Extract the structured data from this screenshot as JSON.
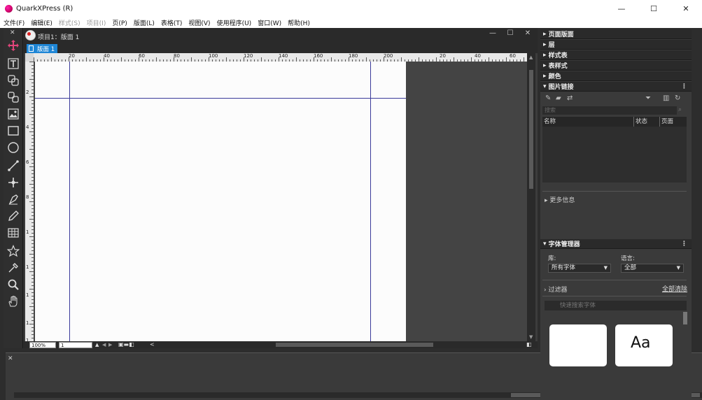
{
  "app": {
    "title": "QuarkXPress (R)"
  },
  "window_controls": {
    "minimize": "—",
    "maximize": "☐",
    "close": "✕"
  },
  "menu": [
    {
      "label": "文件(F)",
      "enabled": true
    },
    {
      "label": "编辑(E)",
      "enabled": true
    },
    {
      "label": "样式(S)",
      "enabled": false
    },
    {
      "label": "项目(I)",
      "enabled": false
    },
    {
      "label": "页(P)",
      "enabled": true
    },
    {
      "label": "版面(L)",
      "enabled": true
    },
    {
      "label": "表格(T)",
      "enabled": true
    },
    {
      "label": "视图(V)",
      "enabled": true
    },
    {
      "label": "使用程序(U)",
      "enabled": true
    },
    {
      "label": "窗口(W)",
      "enabled": true
    },
    {
      "label": "帮助(H)",
      "enabled": true
    }
  ],
  "document": {
    "title": "项目1：版面 1",
    "layout_tab": "版面 1",
    "zoom": "100%",
    "page": "1",
    "ruler_h_labels": [
      "20",
      "40",
      "60",
      "80",
      "100",
      "120",
      "140",
      "160",
      "180",
      "200",
      "20",
      "40",
      "60"
    ],
    "ruler_v_labels": [
      "2",
      "4",
      "6",
      "8",
      "1",
      "1",
      "1",
      "1",
      "1"
    ]
  },
  "right_panels": {
    "page_layout": "页面版面",
    "layers": "层",
    "style_sheets": "样式表",
    "table_styles": "表样式",
    "colors": "颜色",
    "image_links": {
      "title": "图片链接",
      "search_placeholder": "搜索",
      "columns": [
        "名称",
        "状态",
        "页面"
      ],
      "more_info": "更多信息"
    },
    "font_manager": {
      "title": "字体管理器",
      "library_label": "库:",
      "library_value": "所有字体",
      "language_label": "语言:",
      "language_value": "全部",
      "filter_label": "过滤器",
      "clear_all": "全部清除",
      "search_placeholder": "快速搜索字体",
      "preview_sample": "Aa"
    }
  },
  "colors": {
    "accent": "#1e86d6",
    "margin_guide": "#3b3b9a",
    "panel_bg": "#3a3a3a",
    "dark_bg": "#2a2a2a"
  }
}
